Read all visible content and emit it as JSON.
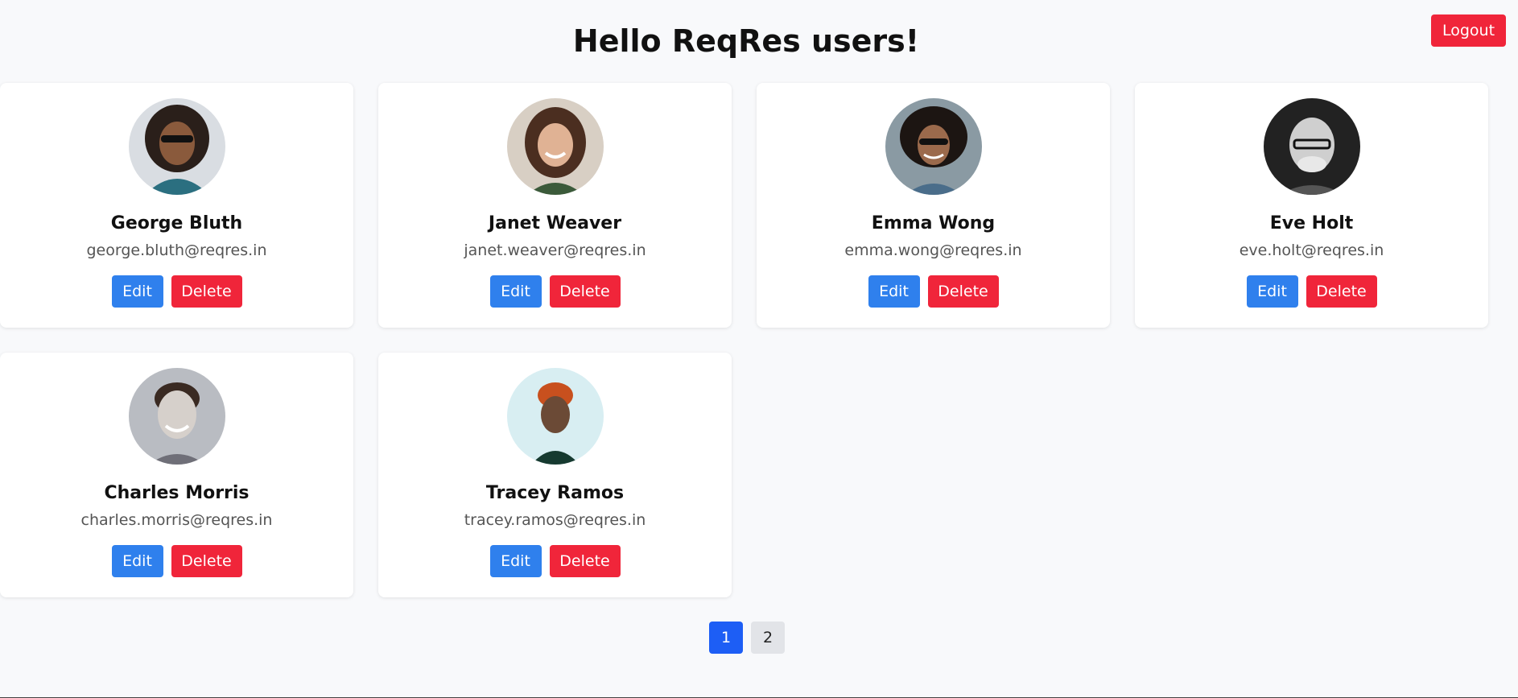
{
  "header": {
    "title": "Hello ReqRes users!",
    "logout_label": "Logout"
  },
  "users": [
    {
      "name": "George Bluth",
      "email": "george.bluth@reqres.in",
      "edit_label": "Edit",
      "delete_label": "Delete"
    },
    {
      "name": "Janet Weaver",
      "email": "janet.weaver@reqres.in",
      "edit_label": "Edit",
      "delete_label": "Delete"
    },
    {
      "name": "Emma Wong",
      "email": "emma.wong@reqres.in",
      "edit_label": "Edit",
      "delete_label": "Delete"
    },
    {
      "name": "Eve Holt",
      "email": "eve.holt@reqres.in",
      "edit_label": "Edit",
      "delete_label": "Delete"
    },
    {
      "name": "Charles Morris",
      "email": "charles.morris@reqres.in",
      "edit_label": "Edit",
      "delete_label": "Delete"
    },
    {
      "name": "Tracey Ramos",
      "email": "tracey.ramos@reqres.in",
      "edit_label": "Edit",
      "delete_label": "Delete"
    }
  ],
  "pagination": {
    "pages": [
      "1",
      "2"
    ],
    "current": "1"
  },
  "colors": {
    "primary": "#2f80ed",
    "danger": "#f0253a",
    "active_page": "#1d5ef5",
    "background": "#f8f9fb"
  }
}
